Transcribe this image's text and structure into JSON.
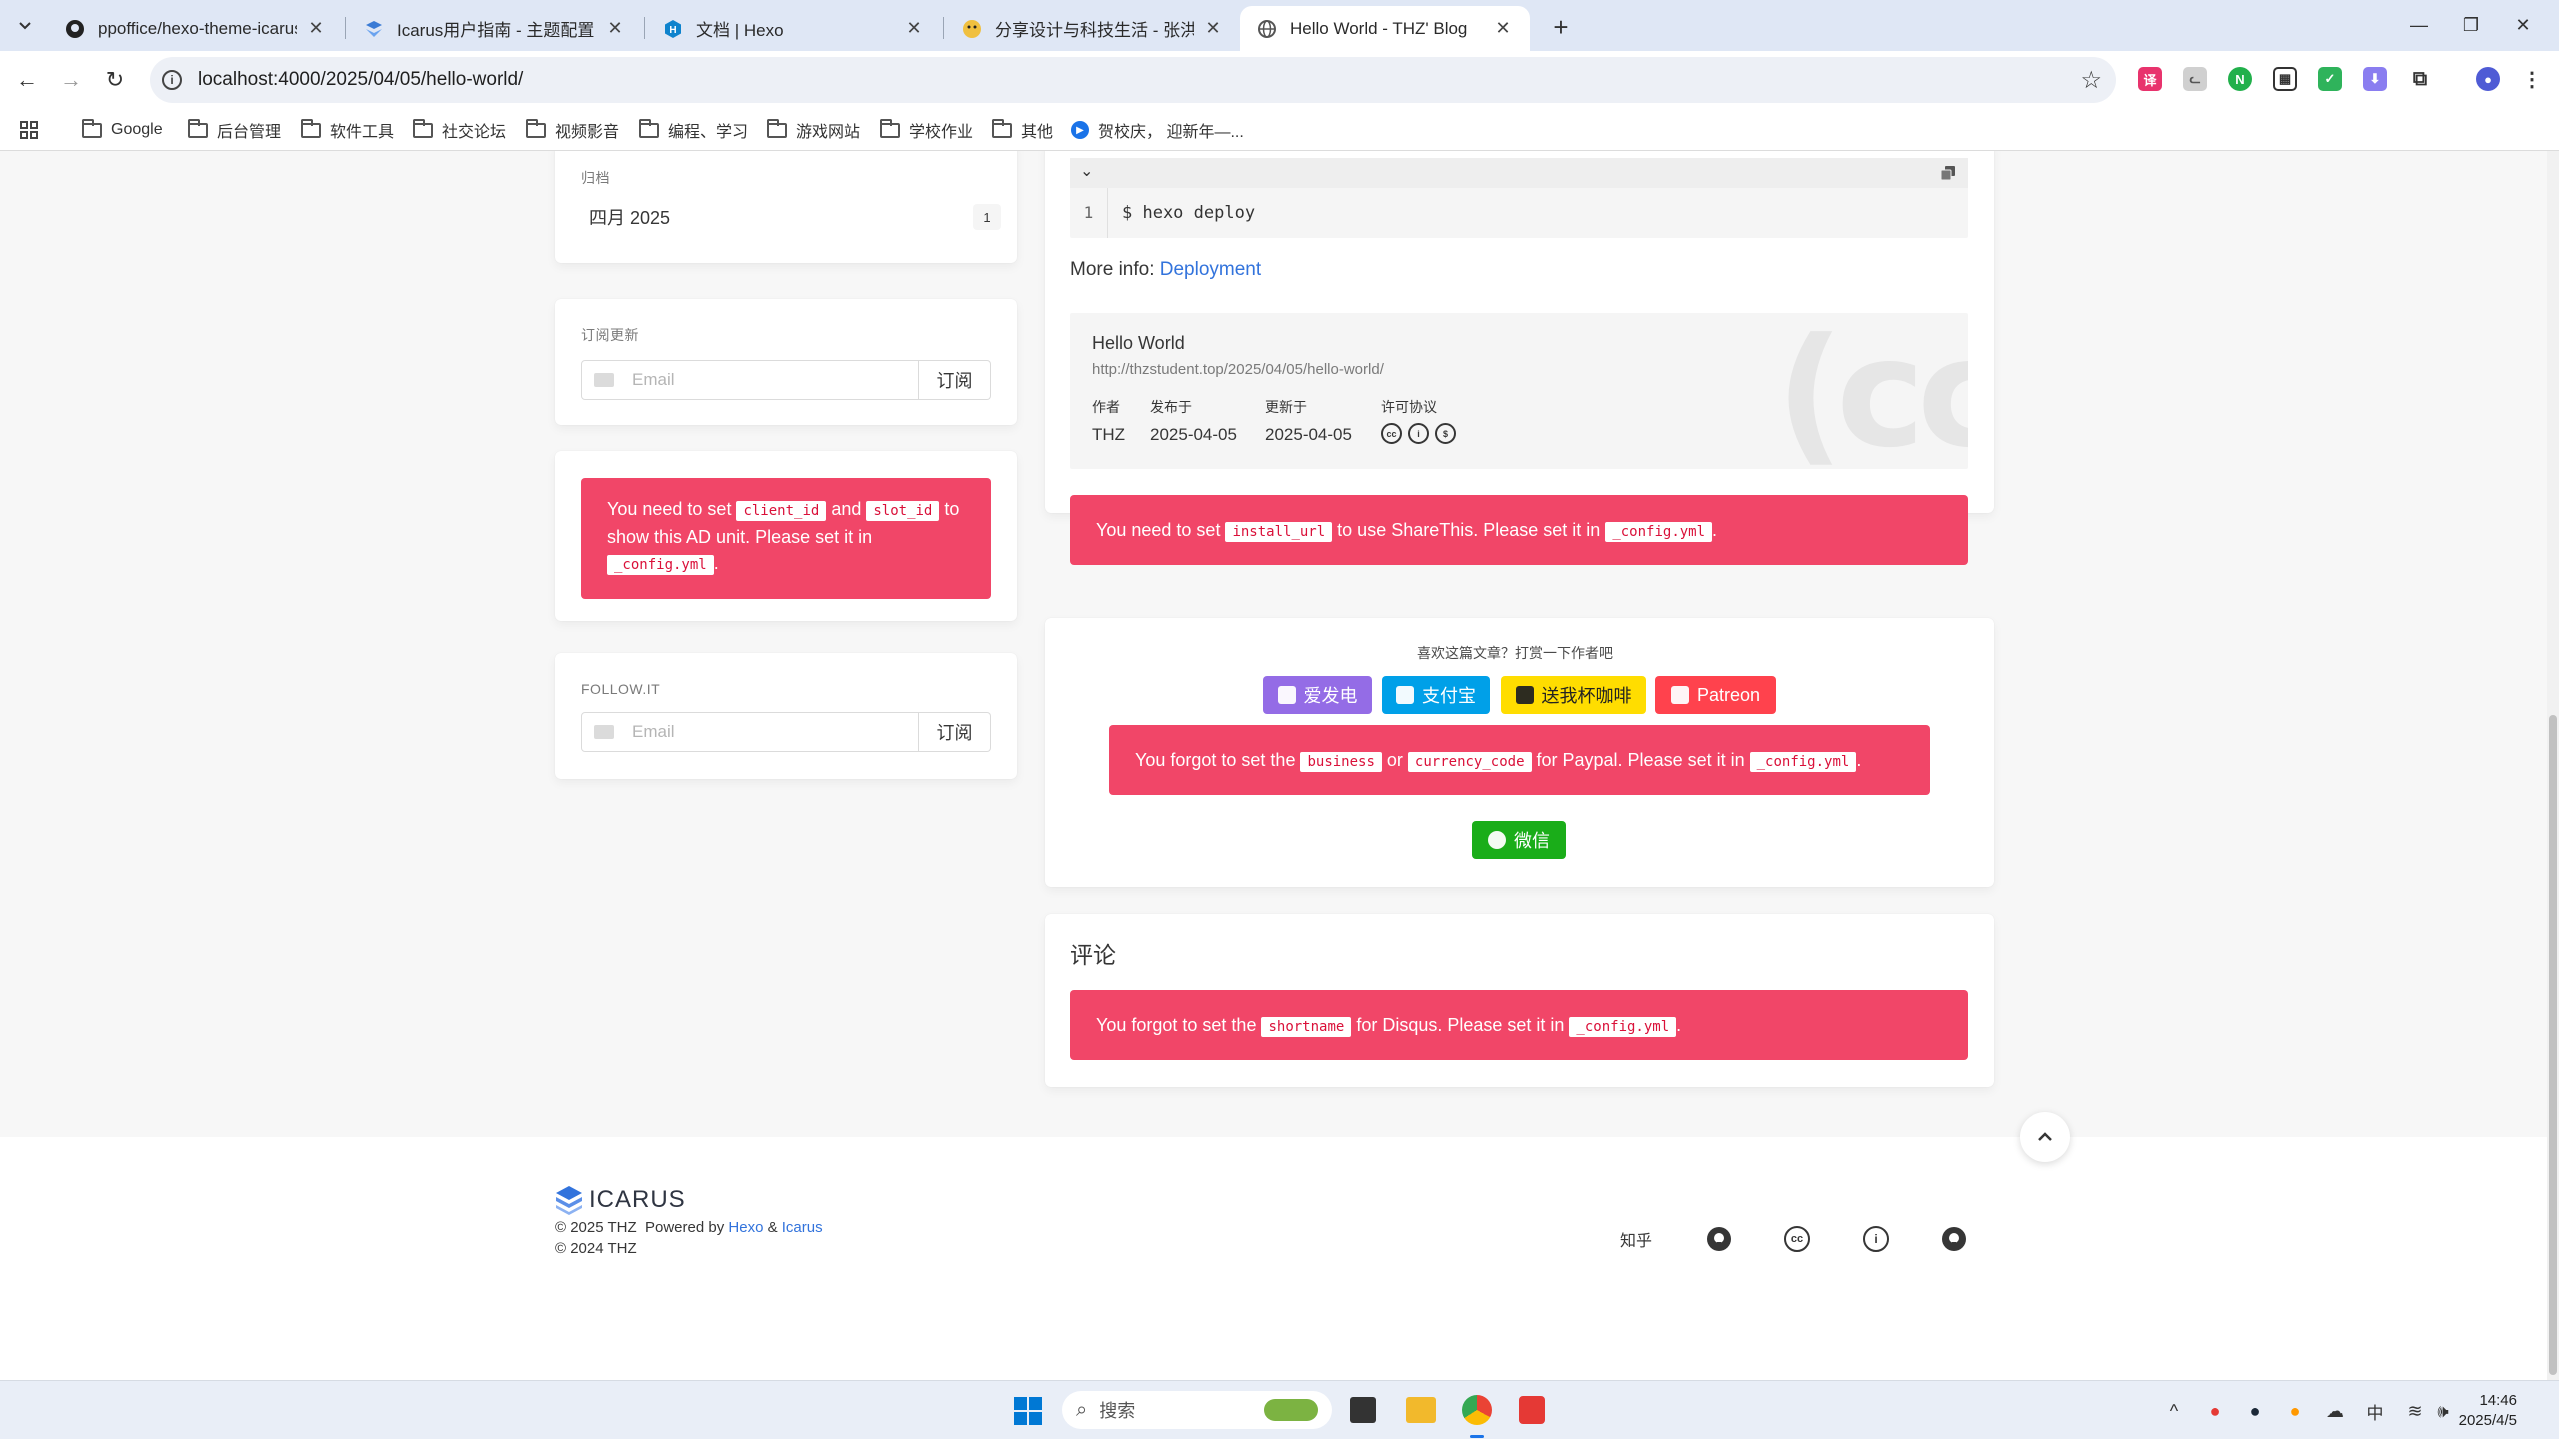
{
  "browser": {
    "tabs": [
      {
        "title": "ppoffice/hexo-theme-icarus:",
        "icon": "github-icon",
        "active": false
      },
      {
        "title": "Icarus用户指南 - 主题配置 - Ic",
        "icon": "icarus-icon",
        "active": false
      },
      {
        "title": "文档 | Hexo",
        "icon": "hexo-icon",
        "active": false
      },
      {
        "title": "分享设计与科技生活 - 张洪Hea",
        "icon": "avatar-icon",
        "active": false
      },
      {
        "title": "Hello World - THZ' Blog",
        "icon": "globe-icon",
        "active": true
      }
    ],
    "url": "localhost:4000/2025/04/05/hello-world/",
    "bookmarks": [
      "Google",
      "后台管理",
      "软件工具",
      "社交论坛",
      "视频影音",
      "编程、学习",
      "游戏网站",
      "学校作业",
      "其他",
      "贺校庆， 迎新年—..."
    ]
  },
  "sidebar": {
    "archive": {
      "label": "归档",
      "item": "四月 2025",
      "count": "1"
    },
    "subscribe": {
      "label": "订阅更新",
      "placeholder": "Email",
      "button": "订阅"
    },
    "ad_notice": {
      "t1": "You need to set ",
      "c1": "client_id",
      "t2": " and ",
      "c2": "slot_id",
      "t3": " to show this AD unit. Please set it in ",
      "c3": "_config.yml",
      "t4": "."
    },
    "followit": {
      "label": "FOLLOW.IT",
      "placeholder": "Email",
      "button": "订阅"
    }
  },
  "article": {
    "code": {
      "line": "1",
      "text": "$ hexo deploy"
    },
    "more_info": {
      "label": "More info: ",
      "link": "Deployment"
    },
    "license": {
      "title": "Hello World",
      "url": "http://thzstudent.top/2025/04/05/hello-world/",
      "author_k": "作者",
      "author_v": "THZ",
      "posted_k": "发布于",
      "posted_v": "2025-04-05",
      "updated_k": "更新于",
      "updated_v": "2025-04-05",
      "license_k": "许可协议",
      "cc_bg": "(cc"
    },
    "share_notice": {
      "t1": "You need to set ",
      "c1": "install_url",
      "t2": " to use ShareThis. Please set it in ",
      "c2": "_config.yml",
      "t3": "."
    }
  },
  "donate": {
    "title": "喜欢这篇文章？打赏一下作者吧",
    "buttons": [
      {
        "label": "爱发电",
        "color": "#946ce6"
      },
      {
        "label": "支付宝",
        "color": "#00a0e8"
      },
      {
        "label": "送我杯咖啡",
        "color": "#ffdd00"
      },
      {
        "label": "Patreon",
        "color": "#ff424d"
      }
    ],
    "paypal_notice": {
      "t1": "You forgot to set the ",
      "c1": "business",
      "t2": " or ",
      "c2": "currency_code",
      "t3": " for Paypal. Please set it in ",
      "c3": "_config.yml",
      "t4": "."
    },
    "wechat": {
      "label": "微信",
      "color": "#1aad19"
    }
  },
  "comments": {
    "title": "评论",
    "notice": {
      "t1": "You forgot to set the ",
      "c1": "shortname",
      "t2": " for Disqus. Please set it in ",
      "c2": "_config.yml",
      "t3": "."
    }
  },
  "footer": {
    "logo": "ICARUS",
    "copyright": "© 2025 THZ",
    "powered": "Powered by ",
    "hexo": "Hexo",
    "amp": " & ",
    "icarus": "Icarus",
    "copyright2": "© 2024 THZ",
    "zhihu": "知乎"
  },
  "taskbar": {
    "search": "搜索",
    "ime": "中",
    "time": "14:46",
    "date": "2025/4/5"
  },
  "colors": {
    "danger": "#f14668",
    "link": "#3273dc",
    "accent_blue": "#1a73e8"
  }
}
